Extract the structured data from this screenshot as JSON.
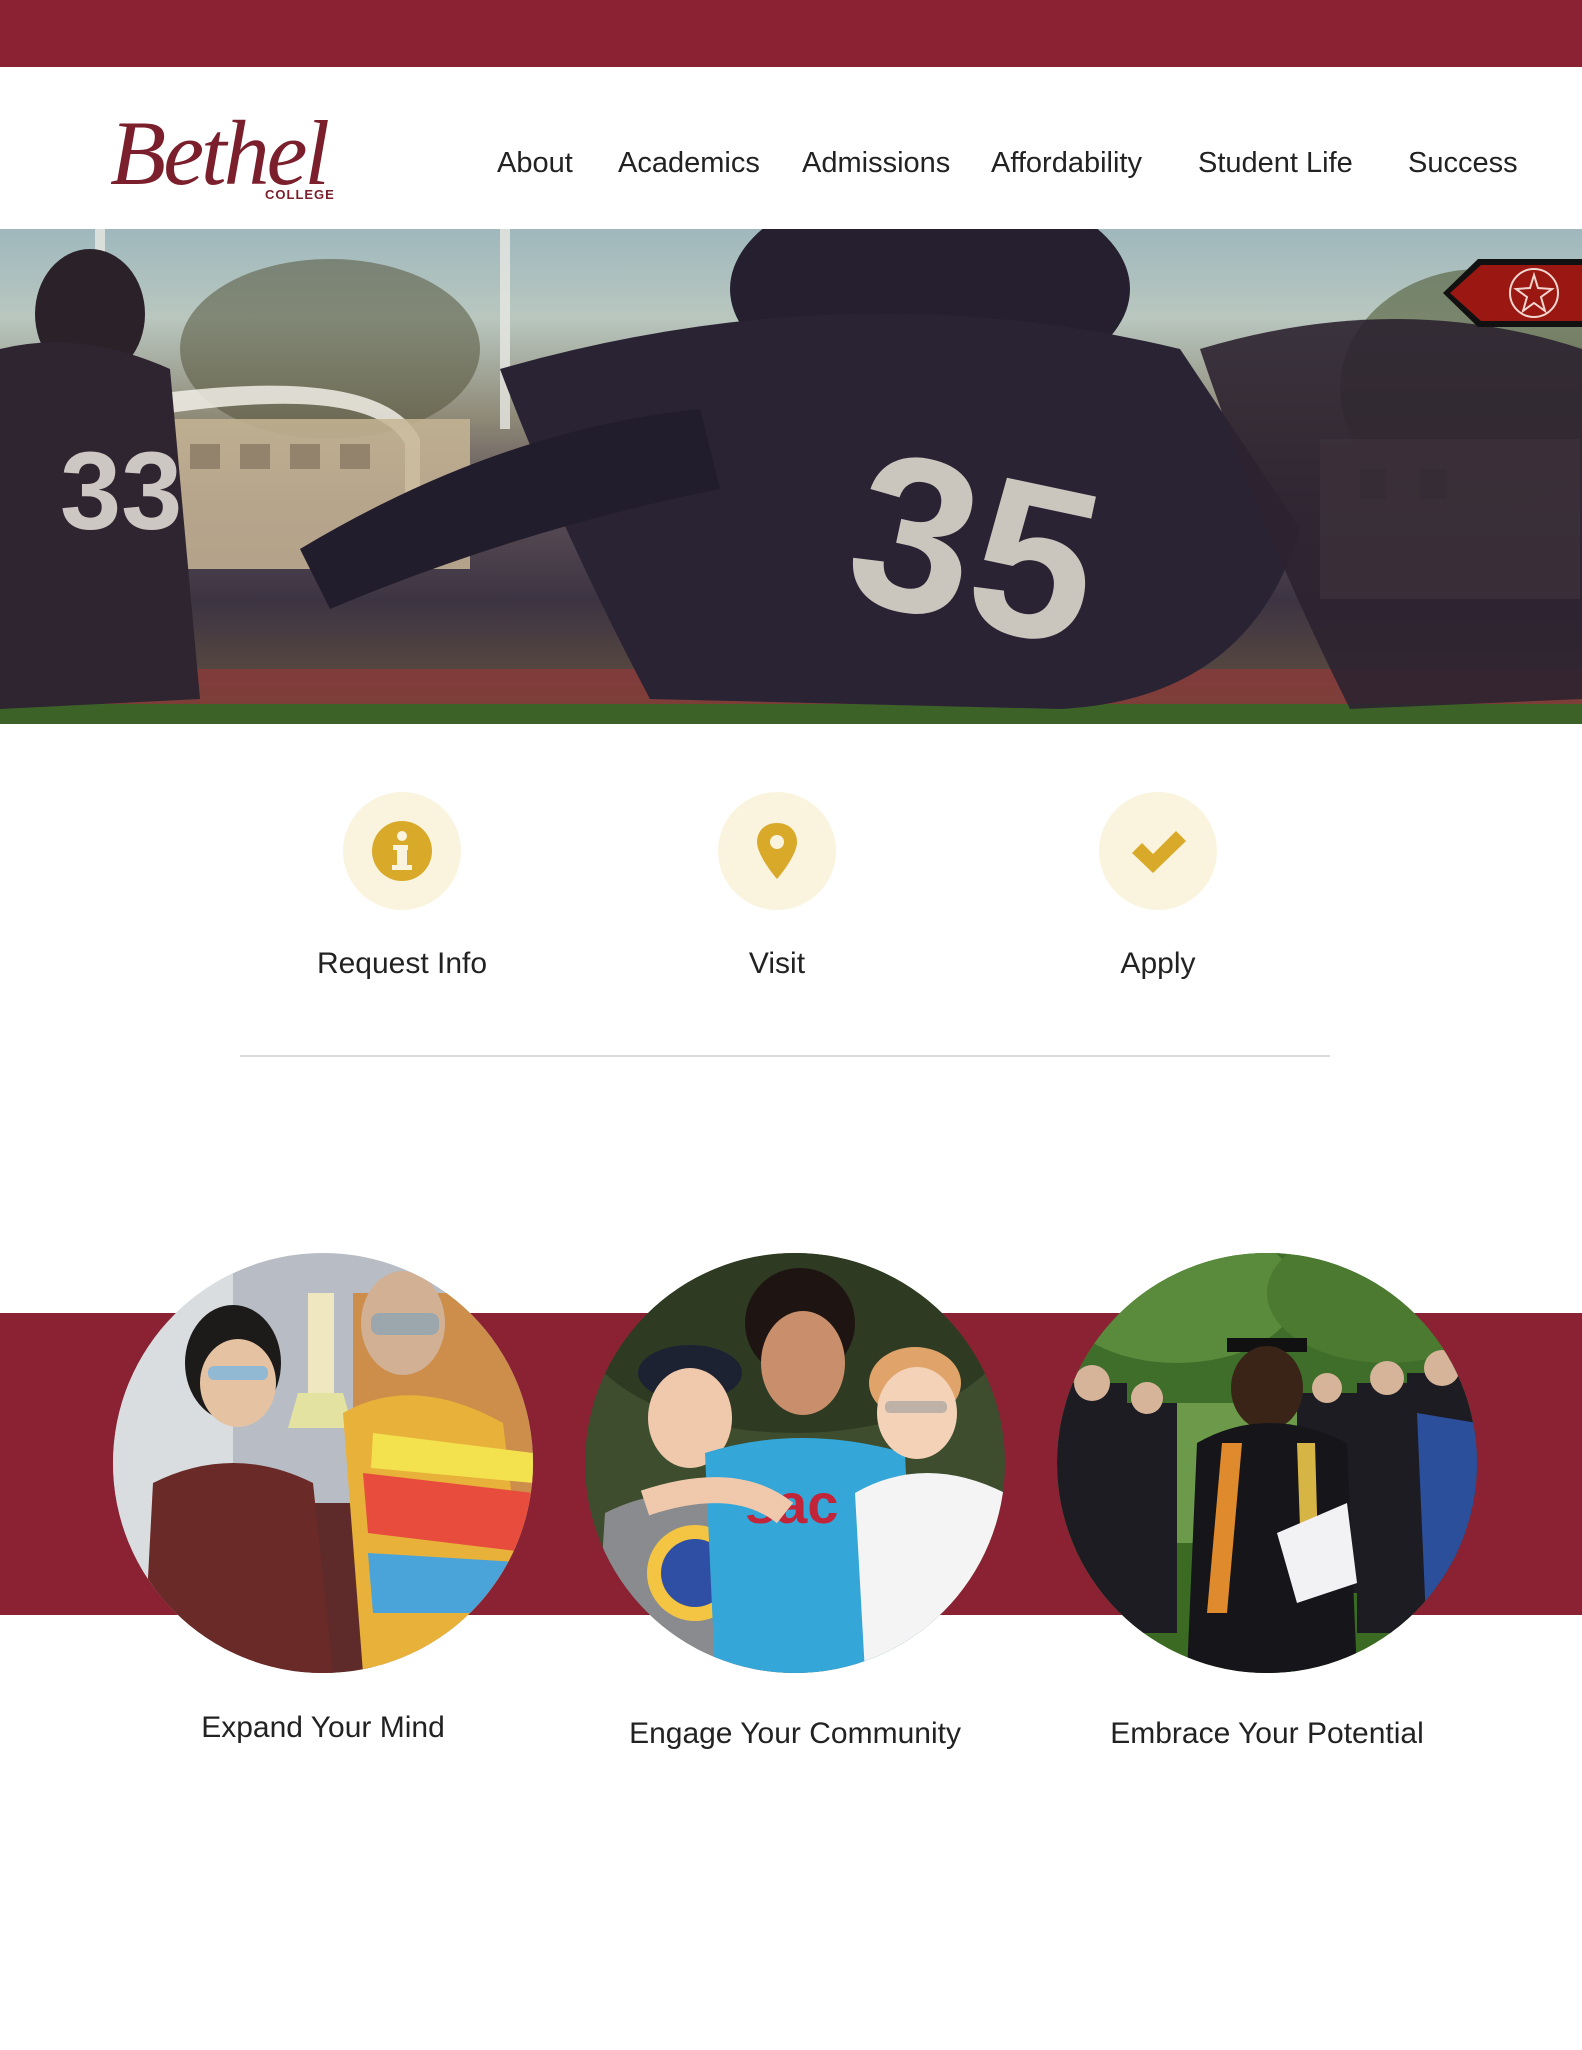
{
  "brand": {
    "name": "Bethel",
    "sub": "COLLEGE",
    "primary_color": "#8a2233",
    "accent_color": "#d9a92a"
  },
  "nav": {
    "items": [
      {
        "label": "About"
      },
      {
        "label": "Academics"
      },
      {
        "label": "Admissions"
      },
      {
        "label": "Affordability"
      },
      {
        "label": "Student Life"
      },
      {
        "label": "Success"
      }
    ]
  },
  "hero": {
    "image": "football-players-action-photo",
    "badge_icon": "compass-star-icon"
  },
  "actions": [
    {
      "label": "Request Info",
      "icon": "info-icon"
    },
    {
      "label": "Visit",
      "icon": "map-pin-icon"
    },
    {
      "label": "Apply",
      "icon": "checkmark-icon"
    }
  ],
  "features": [
    {
      "caption": "Expand Your Mind",
      "image": "students-science-lab-photo"
    },
    {
      "caption": "Engage Your Community",
      "image": "three-students-smiling-photo"
    },
    {
      "caption": "Embrace Your Potential",
      "image": "graduation-ceremony-photo"
    }
  ]
}
